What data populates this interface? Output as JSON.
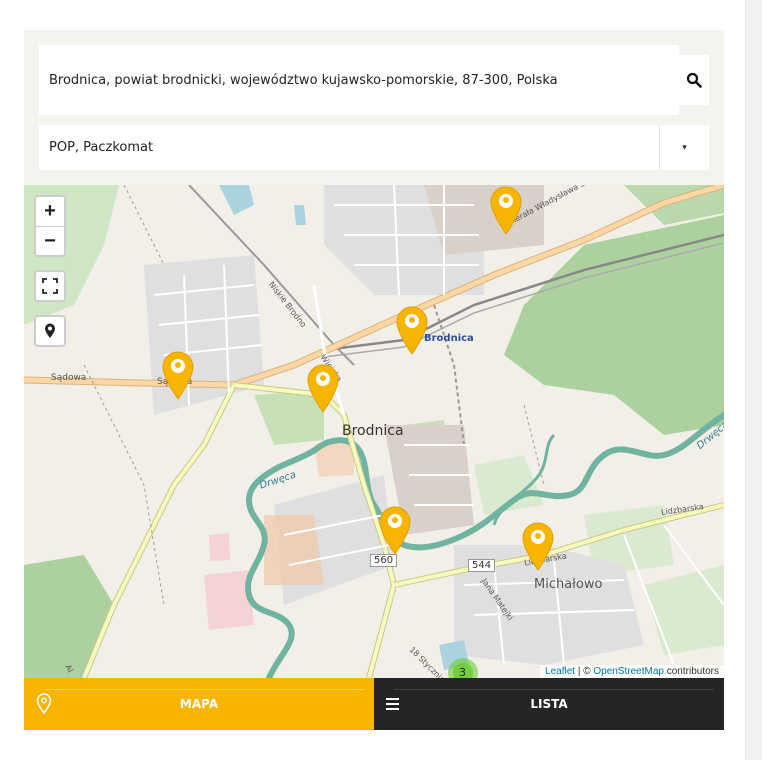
{
  "search": {
    "value": "Brodnica, powiat brodnicki, województwo kujawsko-pomorskie, 87-300, Polska",
    "button_icon": "search-icon"
  },
  "filter": {
    "selected": "POP, Paczkomat",
    "arrow": "▾"
  },
  "map": {
    "labels": {
      "city": "Brodnica",
      "station": "Brodnica",
      "district": "Michałowo",
      "river1": "Drwęca",
      "river2": "Drwęca",
      "street_sadowa1": "Sądowa",
      "street_sadowa2": "Sądowa",
      "street_sikorskiego": "Generała Władysława Sikorskiego",
      "street_nizkie": "Niskie Brodno",
      "street_wiejska": "Wiejska",
      "street_lidzbarska1": "Lidzbarska",
      "street_lidzbarska2": "Lidzbarska",
      "street_mateja": "Jana Matejki",
      "street_stycznia": "18 Stycznia",
      "street_al": "Al"
    },
    "road_badges": {
      "r560": "560",
      "r544": "544"
    },
    "cluster_count": "3",
    "controls": {
      "zoom_in": "+",
      "zoom_out": "−"
    },
    "attribution": {
      "leaflet": "Leaflet",
      "separator": " | © ",
      "osm": "OpenStreetMap",
      "suffix": " contributors"
    },
    "colors": {
      "marker": "#f7b500",
      "river": "#6fb3a0",
      "forest": "#add19e",
      "road_primary": "#fcd6a4",
      "road_secondary": "#f7fabf"
    }
  },
  "tabs": {
    "map_label": "MAPA",
    "list_label": "LISTA",
    "map_icon": "location-pin-icon",
    "list_icon": "list-icon"
  }
}
